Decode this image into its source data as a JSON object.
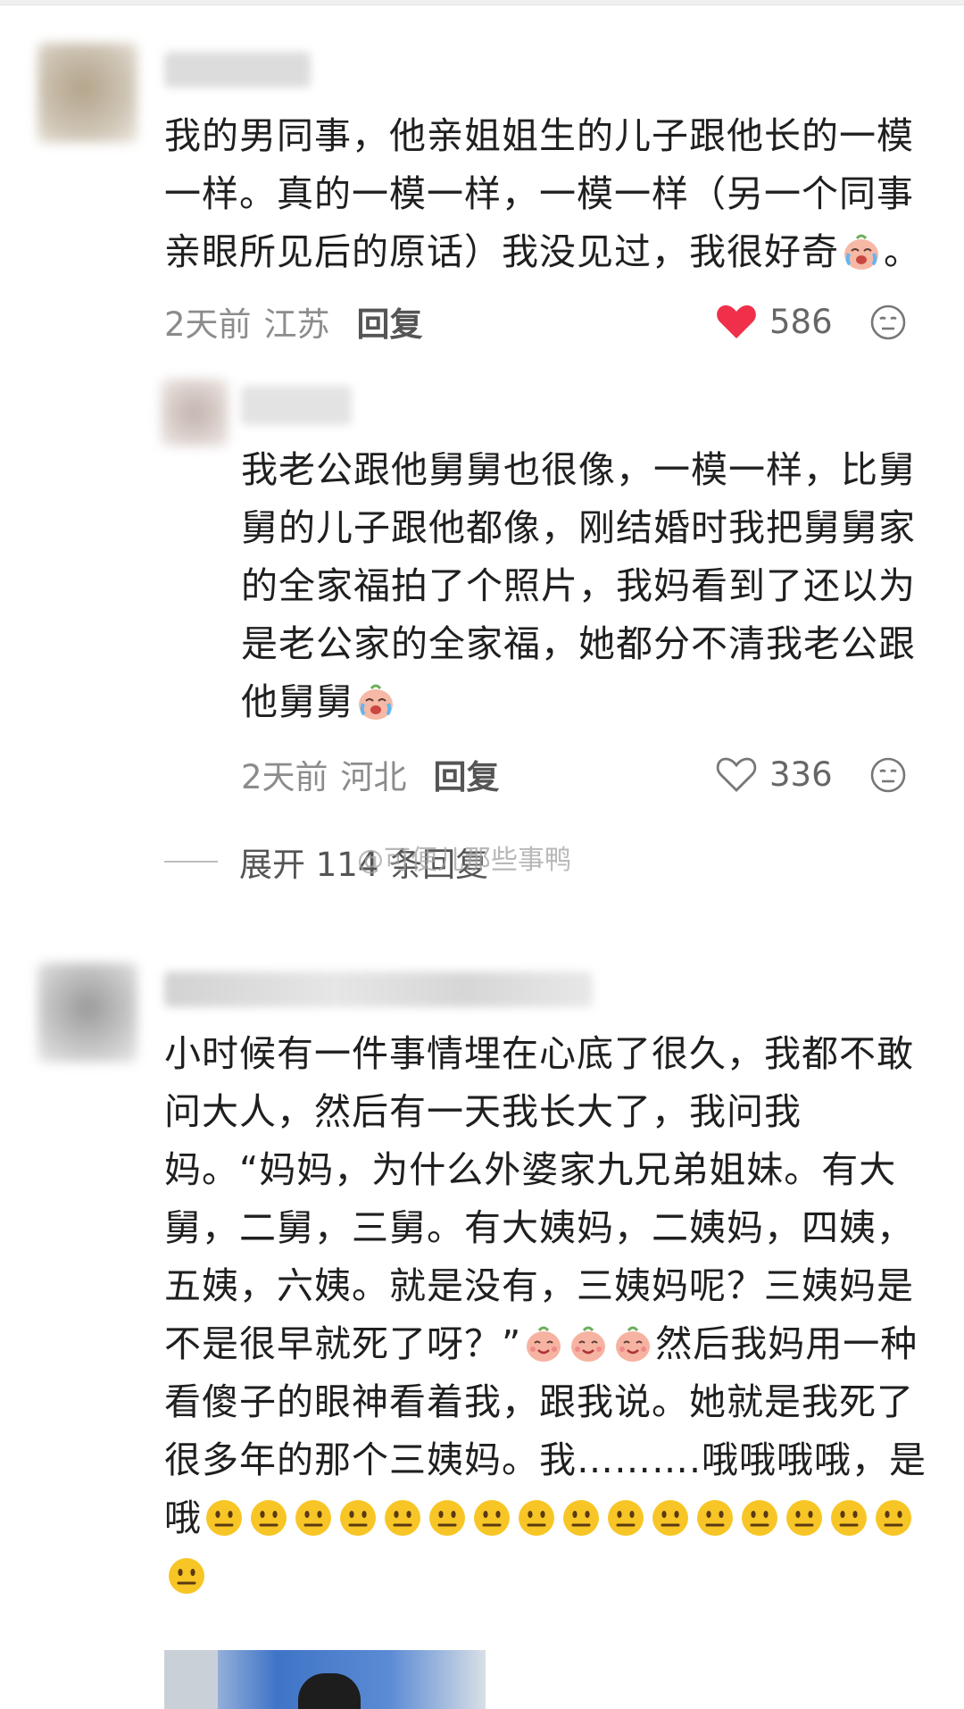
{
  "comments": [
    {
      "text": "我的男同事，他亲姐姐生的儿子跟他长的一模一样。真的一模一样，一模一样（另一个同事亲眼所见后的原话）我没见过，我很好奇",
      "text_end": "。",
      "time": "2天前",
      "location": "江苏",
      "reply_label": "回复",
      "likes": "586",
      "liked": true
    },
    {
      "text": "我老公跟他舅舅也很像，一模一样，比舅舅的儿子跟他都像，刚结婚时我把舅舅家的全家福拍了个照片，我妈看到了还以为是老公家的全家福，她都分不清我老公跟他舅舅",
      "time": "2天前",
      "location": "河北",
      "reply_label": "回复",
      "likes": "336",
      "liked": false
    },
    {
      "text_part1": "小时候有一件事情埋在心底了很久，我都不敢问大人，然后有一天我长大了，我问我妈。“妈妈，为什么外婆家九兄弟姐妹。有大舅，二舅，三舅。有大姨妈，二姨妈，四姨，五姨，六姨。就是没有，三姨妈呢？三姨妈是不是很早就死了呀？”",
      "text_part2": "然后我妈用一种看傻子的眼神看着我，跟我说。她就是我死了很多年的那个三姨妈。我……….哦哦哦哦，是哦"
    }
  ],
  "expand_label": "展开 114 条回复",
  "watermark": "@可便儿那些事鸭",
  "colors": {
    "like_red": "#f0304a",
    "meta_gray": "#8c8c8c"
  },
  "icons": [
    "heart-filled-icon",
    "heart-outline-icon",
    "dislike-face-icon",
    "crying-laugh-emoji",
    "neutral-face-emoji"
  ]
}
